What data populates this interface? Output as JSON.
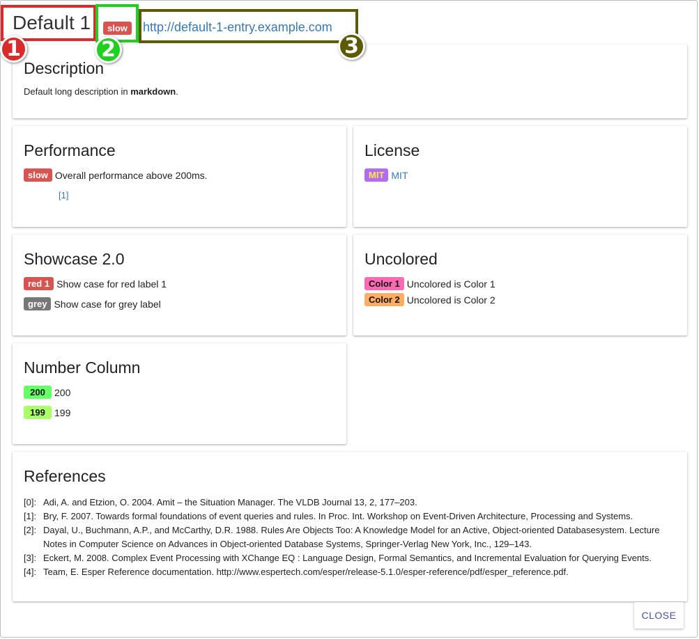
{
  "header": {
    "title": "Default 1",
    "tag": "slow",
    "url": "http://default-1-entry.example.com",
    "tag_color": "#d9534f"
  },
  "description": {
    "heading": "Description",
    "text_before": "Default long description in ",
    "text_bold": "markdown",
    "text_after": "."
  },
  "performance": {
    "heading": "Performance",
    "tag": "slow",
    "tag_color": "#d9534f",
    "text": "Overall performance above 200ms.",
    "ref": "[1]"
  },
  "license": {
    "heading": "License",
    "tag": "MIT",
    "tag_color": "#b26cf4",
    "tag_text_color": "#ffeb3b",
    "text": "MIT"
  },
  "showcase": {
    "heading": "Showcase 2.0",
    "rows": [
      {
        "tag": "red 1",
        "tag_color": "#d9534f",
        "text": "Show case for red label 1"
      },
      {
        "tag": "grey",
        "tag_color": "#777777",
        "text": "Show case for grey label"
      }
    ]
  },
  "uncolored": {
    "heading": "Uncolored",
    "rows": [
      {
        "tag": "Color 1",
        "tag_color": "#ff69b4",
        "text": "Uncolored is Color 1"
      },
      {
        "tag": "Color 2",
        "tag_color": "#ffad60",
        "text": "Uncolored is Color 2"
      }
    ]
  },
  "number_column": {
    "heading": "Number Column",
    "rows": [
      {
        "tag": "200",
        "tag_color": "#66ff66",
        "text": "200"
      },
      {
        "tag": "199",
        "tag_color": "#aaff66",
        "text": "199"
      }
    ]
  },
  "references": {
    "heading": "References",
    "items": [
      {
        "key": "[0]:",
        "text": "Adi, A. and Etzion, O. 2004. Amit – the Situation Manager. The VLDB Journal 13, 2, 177–203."
      },
      {
        "key": "[1]:",
        "text": "Bry, F. 2007. Towards formal foundations of event queries and rules. In Proc. Int. Workshop on Event-Driven Architecture, Processing and Systems."
      },
      {
        "key": "[2]:",
        "text": "Dayal, U., Buchmann, A.P., and McCarthy, D.R. 1988. Rules Are Objects Too: A Knowledge Model for an Active, Object-oriented Databasesystem. Lecture Notes in Computer Science on Advances in Object-oriented Database Systems, Springer-Verlag New York, Inc., 129–143."
      },
      {
        "key": "[3]:",
        "text": "Eckert, M. 2008. Complex Event Processing with XChange EQ : Language Design, Formal Semantics, and Incremental Evaluation for Querying Events."
      },
      {
        "key": "[4]:",
        "text": "Team, E. Esper Reference documentation. http://www.espertech.com/esper/release-5.1.0/esper-reference/pdf/esper_reference.pdf."
      }
    ]
  },
  "footer": {
    "close_label": "CLOSE"
  },
  "annotations": {
    "one": "1",
    "two": "2",
    "three": "3"
  }
}
